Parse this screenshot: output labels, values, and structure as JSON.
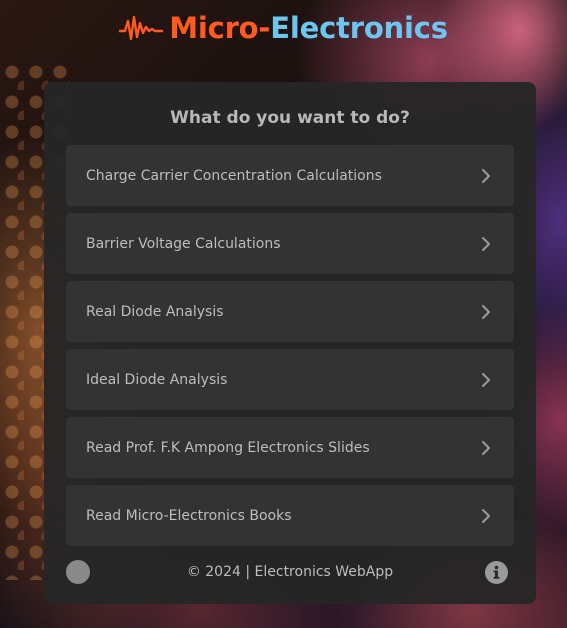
{
  "header": {
    "logo_part1": "Micro-",
    "logo_part2": "Electronics",
    "logo_icon": "waveform-icon",
    "colors": {
      "primary": "#ff5a1f",
      "secondary": "#6cc6f0"
    }
  },
  "main": {
    "title": "What do you want to do?",
    "items": [
      {
        "label": "Charge Carrier Concentration Calculations",
        "icon": "chevron-right-icon"
      },
      {
        "label": "Barrier Voltage Calculations",
        "icon": "chevron-right-icon"
      },
      {
        "label": "Real Diode Analysis",
        "icon": "chevron-right-icon"
      },
      {
        "label": "Ideal Diode Analysis",
        "icon": "chevron-right-icon"
      },
      {
        "label": "Read Prof. F.K Ampong Electronics Slides",
        "icon": "chevron-right-icon"
      },
      {
        "label": "Read Micro-Electronics Books",
        "icon": "chevron-right-icon"
      }
    ]
  },
  "footer": {
    "text": "© 2024 | Electronics WebApp",
    "theme_toggle_icon": "circle-toggle-icon",
    "info_icon": "info-icon"
  }
}
